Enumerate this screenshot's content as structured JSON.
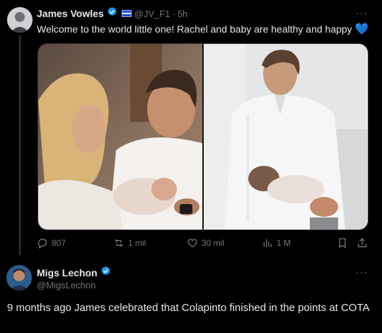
{
  "tweet": {
    "author_name": "James Vowles",
    "handle": "@JV_F1",
    "separator": "·",
    "time": "5h",
    "text": "Welcome to the world little one! Rachel and baby are healthy and happy",
    "emoji": "💙",
    "more": "···",
    "stats": {
      "replies": "807",
      "reposts": "1 mil",
      "likes": "30 mil",
      "views": "1 M"
    }
  },
  "reply": {
    "author_name": "Migs Lechon",
    "handle": "@MigsLechon",
    "more": "···",
    "text": "9 months ago James celebrated that Colapinto finished in the points at COTA"
  },
  "colors": {
    "background": "#000000",
    "text": "#e7e9ea",
    "muted": "#71767b",
    "verified": "#1d9bf0",
    "divider": "#333639"
  }
}
